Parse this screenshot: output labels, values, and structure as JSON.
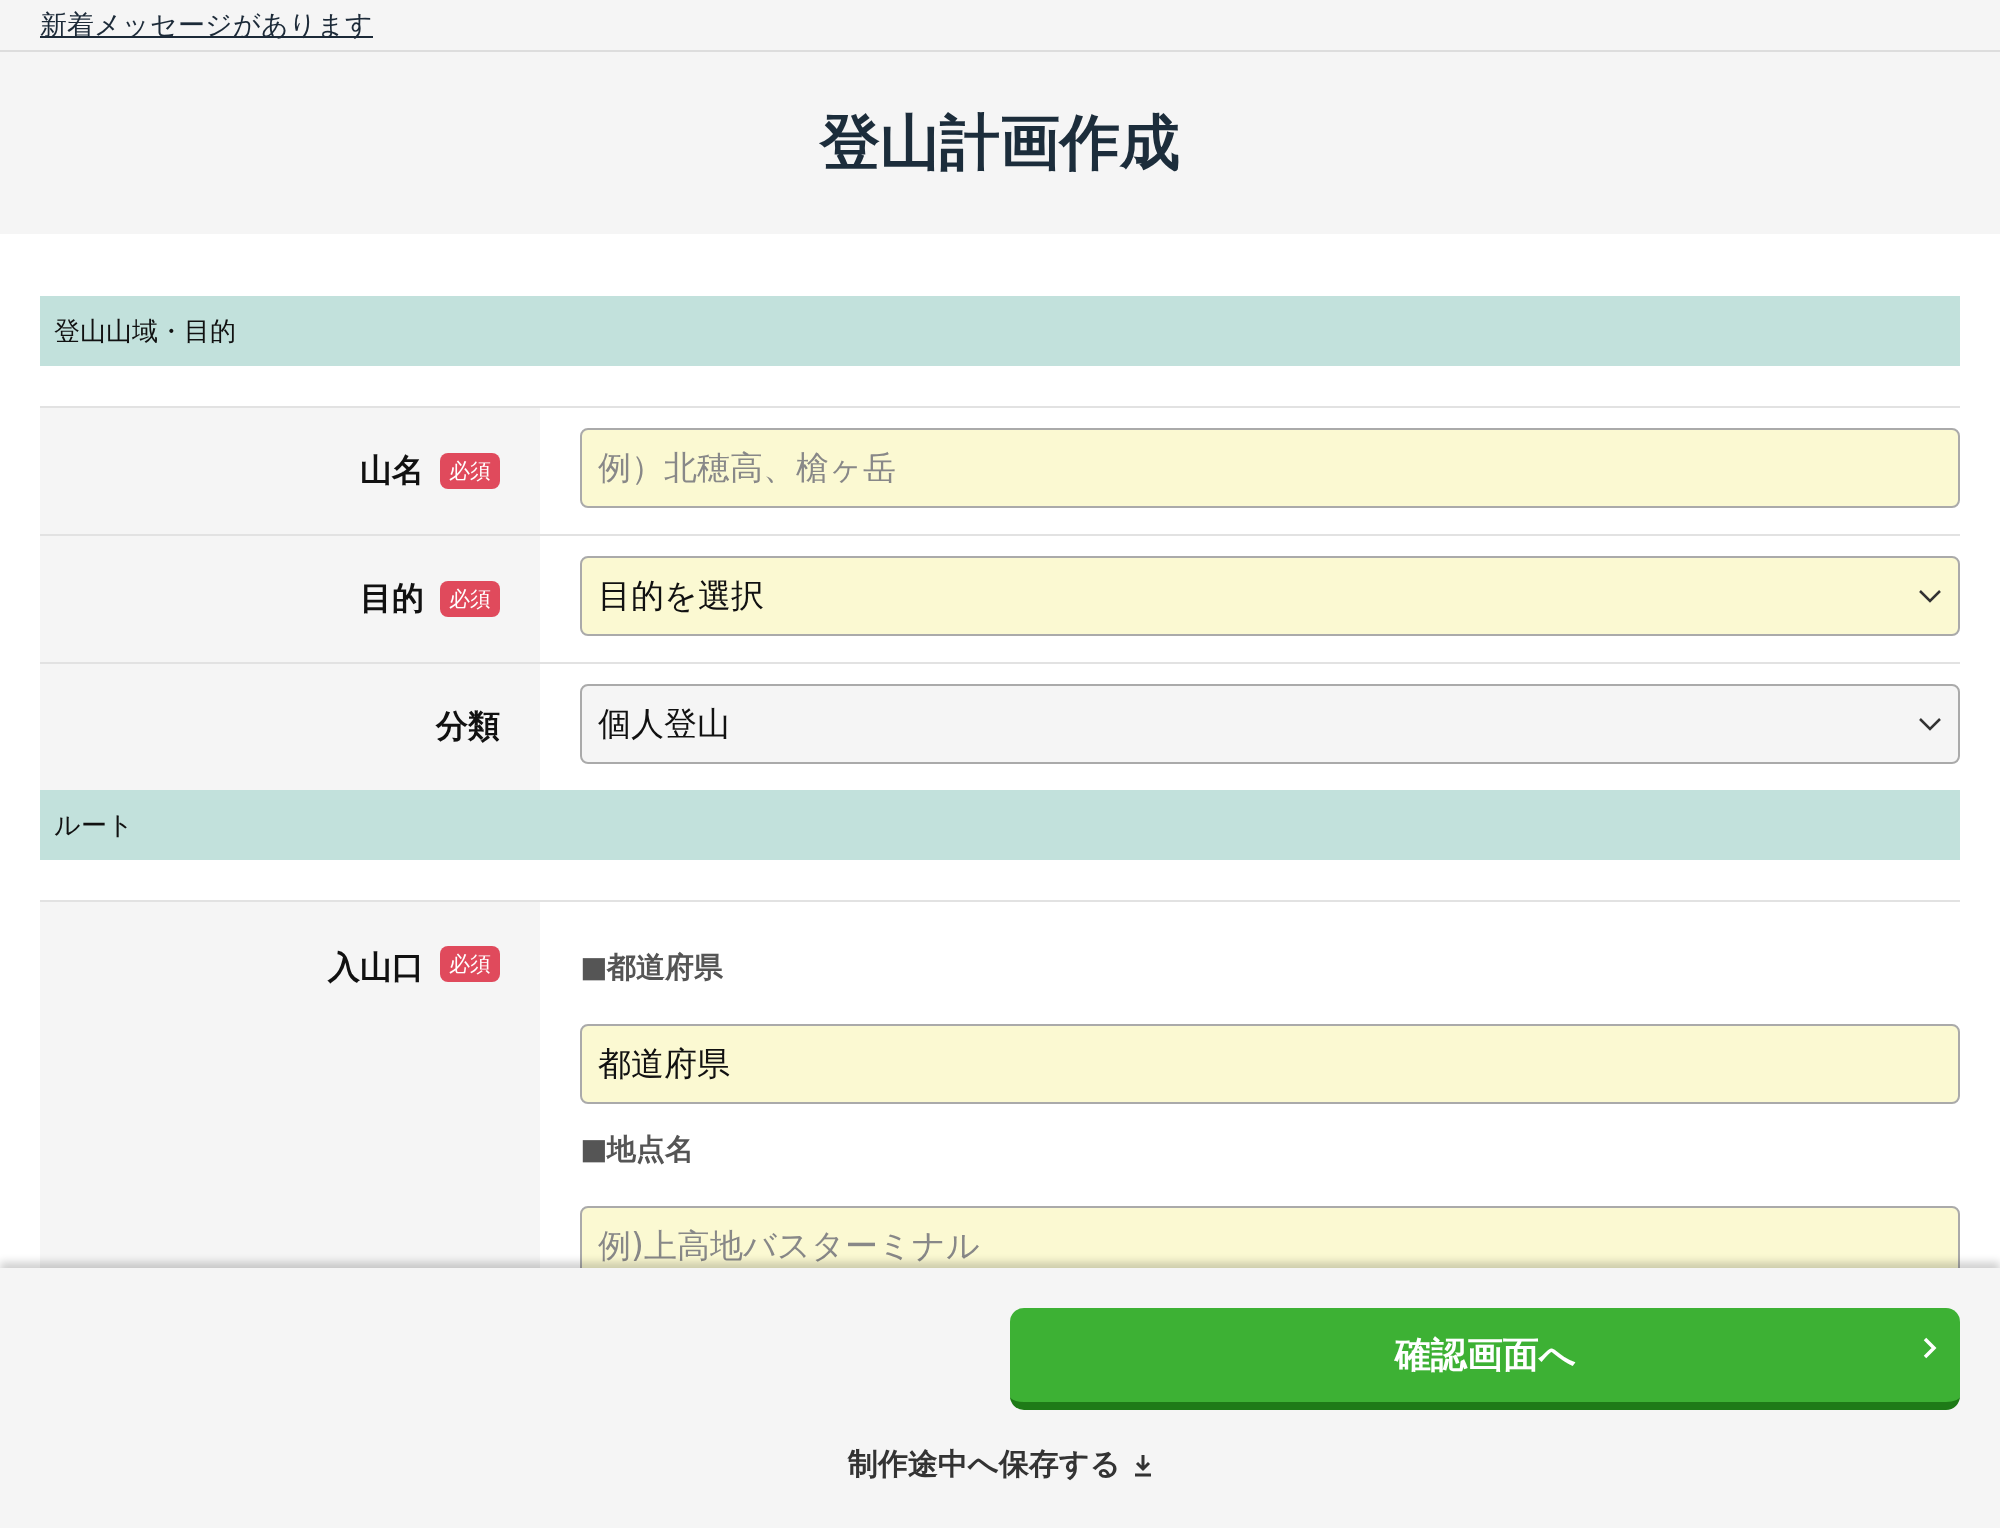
{
  "notice_link": "新着メッセージがあります",
  "page_title": "登山計画作成",
  "sections": [
    {
      "title": "登山山域・目的",
      "rows": [
        {
          "label": "山名",
          "required": true,
          "required_badge": "必須",
          "fields": [
            {
              "kind": "text",
              "placeholder": "例）北穂高、槍ヶ岳",
              "highlighted": true
            }
          ]
        },
        {
          "label": "目的",
          "required": true,
          "required_badge": "必須",
          "fields": [
            {
              "kind": "select",
              "value": "目的を選択",
              "highlighted": true
            }
          ]
        },
        {
          "label": "分類",
          "required": false,
          "fields": [
            {
              "kind": "select",
              "value": "個人登山",
              "highlighted": false
            }
          ]
        }
      ]
    },
    {
      "title": "ルート",
      "rows": [
        {
          "label": "入山口",
          "required": true,
          "required_badge": "必須",
          "fields": [
            {
              "kind": "heading",
              "text": "■都道府県"
            },
            {
              "kind": "text",
              "value": "都道府県",
              "highlighted": true
            },
            {
              "kind": "heading",
              "text": "■地点名"
            },
            {
              "kind": "text",
              "placeholder": "例)上高地バスターミナル",
              "highlighted": true
            }
          ]
        }
      ]
    }
  ],
  "footer": {
    "confirm_button": "確認画面へ",
    "save_link": "制作途中へ保存する"
  }
}
